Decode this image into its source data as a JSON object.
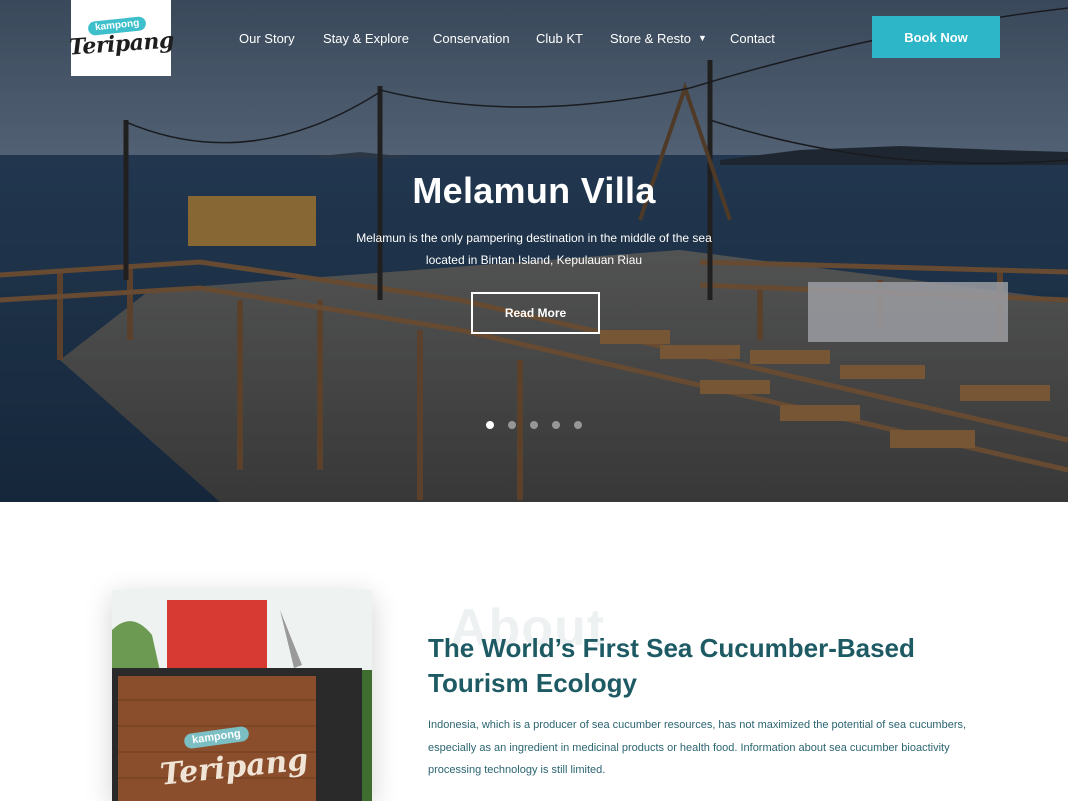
{
  "logo": {
    "badge": "kampong",
    "wordmark": "Teripang"
  },
  "nav": {
    "items": [
      {
        "label": "Our Story"
      },
      {
        "label": "Stay & Explore"
      },
      {
        "label": "Conservation"
      },
      {
        "label": "Club KT"
      },
      {
        "label": "Store & Resto",
        "has_dropdown": true
      },
      {
        "label": "Contact"
      }
    ],
    "book_label": "Book Now"
  },
  "hero": {
    "title": "Melamun Villa",
    "subtitle_line1": "Melamun is the only pampering destination in the middle of the sea",
    "subtitle_line2": "located in Bintan Island, Kepulauan Riau",
    "cta": "Read More",
    "slide_count": 5,
    "active_slide": 1
  },
  "about": {
    "ghost": "About",
    "title_line1": "The World’s First Sea Cucumber-Based",
    "title_line2": "Tourism Ecology",
    "body_line1": "Indonesia, which is a producer of sea cucumber resources, has not maximized the potential of sea cucumbers,",
    "body_line2": "especially as an ingredient in medicinal products or health food. Information about sea cucumber bioactivity",
    "body_line3": "processing technology is still limited.",
    "image_sign": {
      "badge": "kampong",
      "wordmark": "Teripang"
    }
  },
  "colors": {
    "accent": "#2db5c8",
    "heading": "#1d5a63",
    "body_text": "#2b6470"
  },
  "icons": {
    "dropdown": "caret-down-icon"
  }
}
